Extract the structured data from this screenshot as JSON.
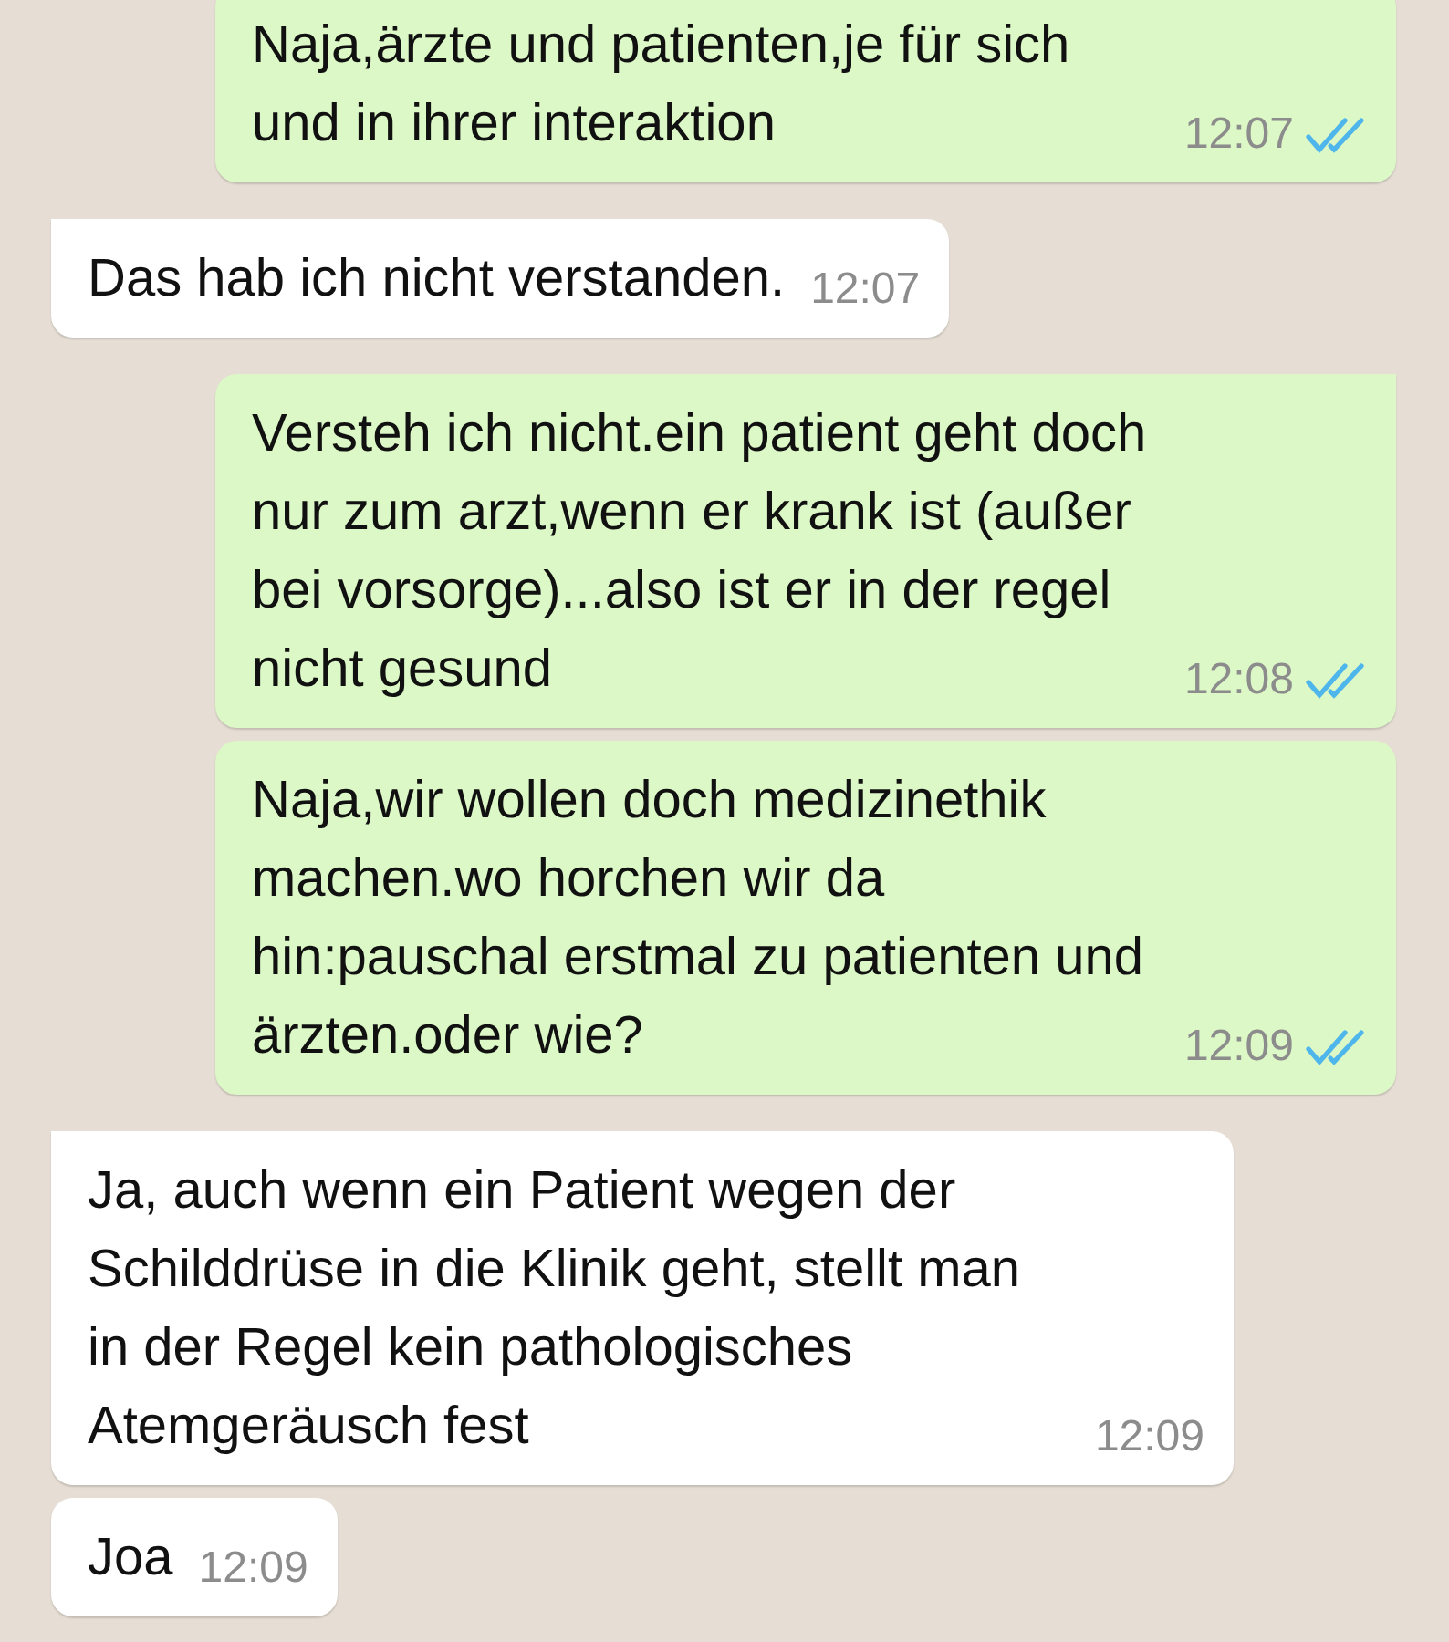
{
  "messages": [
    {
      "kind": "sent",
      "text": "Naja,ärzte und patienten,je für sich und in ihrer interaktion",
      "time": "12:07",
      "read": true,
      "tail": false
    },
    {
      "kind": "received",
      "text": "Das hab ich nicht verstanden.",
      "time": "12:07",
      "tail": true
    },
    {
      "kind": "sent",
      "text": "Versteh ich nicht.ein patient geht doch nur zum arzt,wenn er krank ist (außer bei vorsorge)...also ist er in der regel nicht gesund",
      "time": "12:08",
      "read": true,
      "tail": true
    },
    {
      "kind": "sent",
      "text": "Naja,wir wollen doch medizinethik machen.wo horchen wir da hin:pauschal erstmal zu patienten und ärzten.oder wie?",
      "time": "12:09",
      "read": true,
      "tail": false
    },
    {
      "kind": "received",
      "text": "Ja, auch wenn ein Patient wegen der Schilddrüse in die Klinik geht, stellt man in der Regel kein pathologisches Atemgeräusch fest",
      "time": "12:09",
      "tail": true
    },
    {
      "kind": "received",
      "text": "Joa",
      "time": "12:09",
      "tail": false
    }
  ]
}
